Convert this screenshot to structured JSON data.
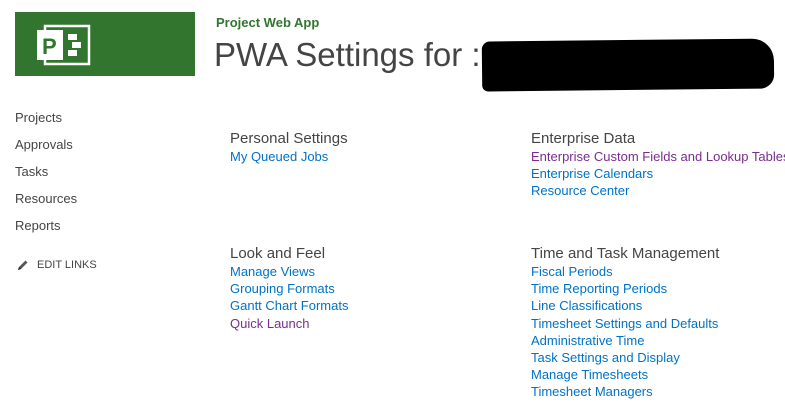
{
  "header": {
    "site_title": "Project Web App",
    "page_title": "PWA Settings for :",
    "logo_icon": "project-logo-icon",
    "brand_color": "#31752f"
  },
  "nav": {
    "items": [
      {
        "label": "Projects"
      },
      {
        "label": "Approvals"
      },
      {
        "label": "Tasks"
      },
      {
        "label": "Resources"
      },
      {
        "label": "Reports"
      }
    ],
    "edit_links": {
      "label": "EDIT LINKS",
      "icon": "pencil-icon"
    }
  },
  "sections": {
    "personal_settings": {
      "heading": "Personal Settings",
      "links": [
        {
          "label": "My Queued Jobs"
        }
      ]
    },
    "enterprise_data": {
      "heading": "Enterprise Data",
      "links": [
        {
          "label": "Enterprise Custom Fields and Lookup Tables",
          "visited": true
        },
        {
          "label": "Enterprise Calendars"
        },
        {
          "label": "Resource Center"
        }
      ]
    },
    "look_and_feel": {
      "heading": "Look and Feel",
      "links": [
        {
          "label": "Manage Views"
        },
        {
          "label": "Grouping Formats"
        },
        {
          "label": "Gantt Chart Formats"
        },
        {
          "label": "Quick Launch",
          "visited": true
        }
      ]
    },
    "time_and_task": {
      "heading": "Time and Task Management",
      "links": [
        {
          "label": "Fiscal Periods"
        },
        {
          "label": "Time Reporting Periods"
        },
        {
          "label": "Line Classifications"
        },
        {
          "label": "Timesheet Settings and Defaults"
        },
        {
          "label": "Administrative Time"
        },
        {
          "label": "Task Settings and Display"
        },
        {
          "label": "Manage Timesheets"
        },
        {
          "label": "Timesheet Managers"
        }
      ]
    }
  },
  "colors": {
    "link": "#0072c6",
    "visited_link": "#7a2d8f",
    "text": "#444444"
  }
}
